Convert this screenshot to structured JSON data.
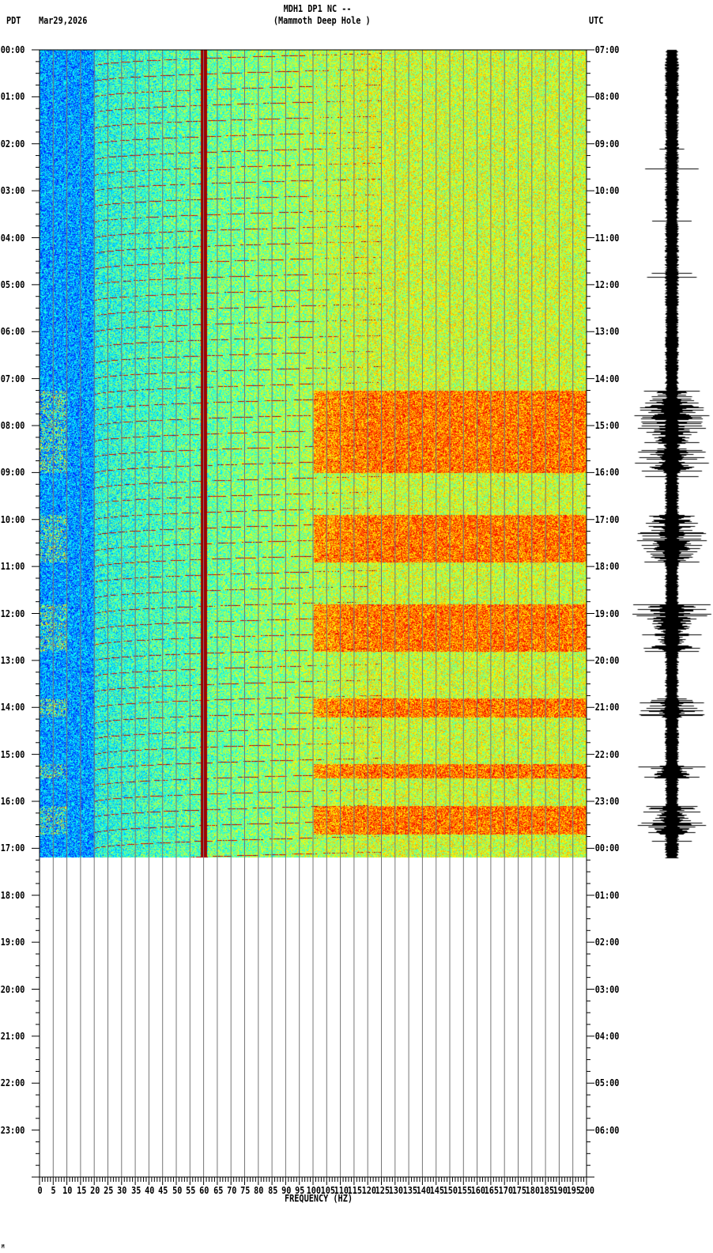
{
  "header": {
    "title": "MDH1 DP1 NC --",
    "subtitle": "(Mammoth Deep Hole )",
    "left_tz": "PDT",
    "date": "Mar29,2026",
    "right_tz": "UTC"
  },
  "chart_data": {
    "type": "heatmap",
    "title": "MDH1 DP1 NC --",
    "subtitle": "(Mammoth Deep Hole )",
    "xlabel": "FREQUENCY (HZ)",
    "xlim": [
      0,
      200
    ],
    "x_ticks": [
      "0",
      "5",
      "10",
      "15",
      "20",
      "25",
      "30",
      "35",
      "40",
      "45",
      "50",
      "55",
      "60",
      "65",
      "70",
      "75",
      "80",
      "85",
      "90",
      "95",
      "100",
      "105",
      "110",
      "115",
      "120",
      "125",
      "130",
      "135",
      "140",
      "145",
      "150",
      "155",
      "160",
      "165",
      "170",
      "175",
      "180",
      "185",
      "190",
      "195",
      "200"
    ],
    "y_left_label": "PDT",
    "y_right_label": "UTC",
    "ylim_hours": [
      0,
      24
    ],
    "y_left_ticks": [
      "00:00",
      "01:00",
      "02:00",
      "03:00",
      "04:00",
      "05:00",
      "06:00",
      "07:00",
      "08:00",
      "09:00",
      "10:00",
      "11:00",
      "12:00",
      "13:00",
      "14:00",
      "15:00",
      "16:00",
      "17:00",
      "18:00",
      "19:00",
      "20:00",
      "21:00",
      "22:00",
      "23:00"
    ],
    "y_right_ticks": [
      "07:00",
      "08:00",
      "09:00",
      "10:00",
      "11:00",
      "12:00",
      "13:00",
      "14:00",
      "15:00",
      "16:00",
      "17:00",
      "18:00",
      "19:00",
      "20:00",
      "21:00",
      "22:00",
      "23:00",
      "00:00",
      "01:00",
      "02:00",
      "03:00",
      "04:00",
      "05:00",
      "06:00"
    ],
    "data_end_hour_pdt": 17.2,
    "persistent_line_hz": 60,
    "grid": true,
    "colormap": "jet",
    "noise_bursts_pdt_hours": [
      [
        7.25,
        9.0
      ],
      [
        9.9,
        10.9
      ],
      [
        11.8,
        12.8
      ],
      [
        13.8,
        14.2
      ],
      [
        15.2,
        15.5
      ],
      [
        16.1,
        16.7
      ]
    ]
  },
  "footer_mark": "M"
}
